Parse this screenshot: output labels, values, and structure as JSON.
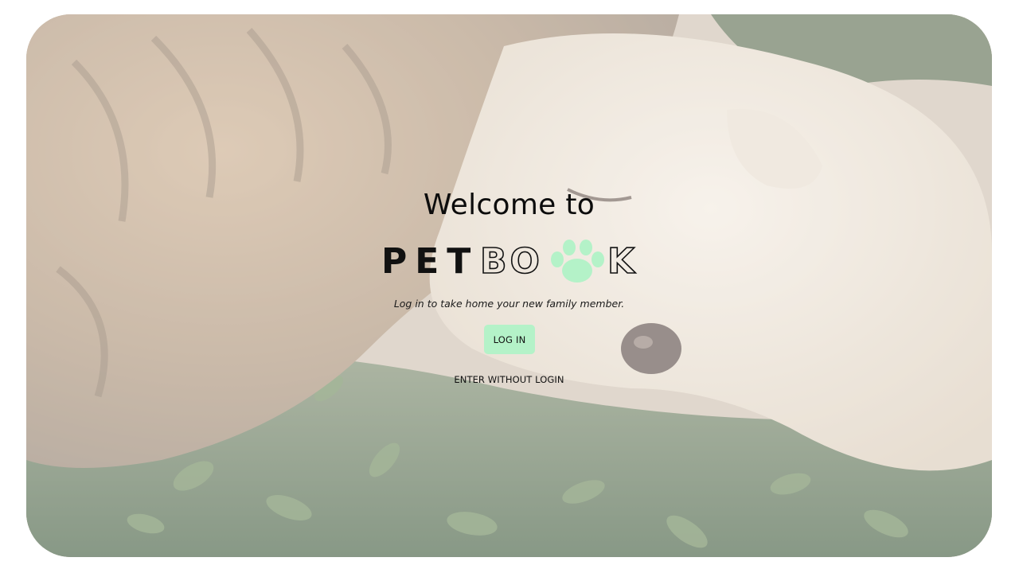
{
  "hero": {
    "background_image": "cat-and-dog-lying-in-grass-photo",
    "welcome_text": "Welcome to",
    "logo": {
      "text_bold": "PET",
      "text_outline": "BO",
      "text_outline_end": "K",
      "paw_icon": "paw-print-icon",
      "paw_color": "#b4f2c8"
    },
    "tagline": "Log in to take home your new family member.",
    "login_button": "LOG IN",
    "skip_link": "ENTER WITHOUT LOGIN"
  },
  "colors": {
    "accent": "#b4f2c8",
    "text": "#111111"
  }
}
